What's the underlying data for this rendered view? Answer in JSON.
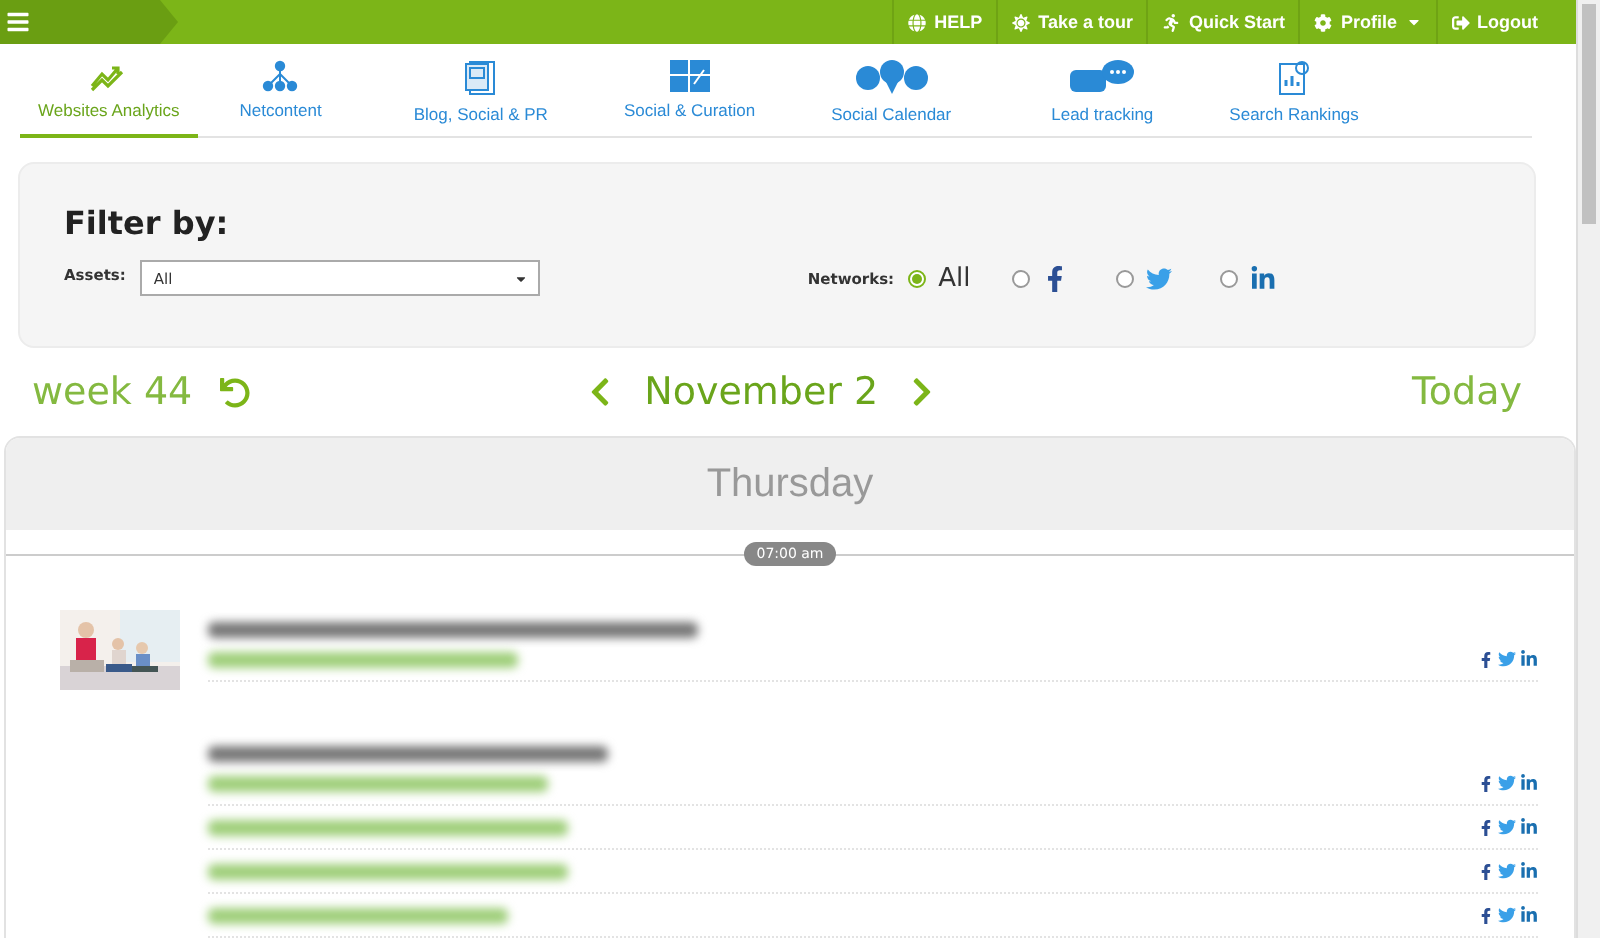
{
  "topbar": {
    "items": [
      {
        "label": "HELP",
        "kind": "link"
      },
      {
        "label": "Take a tour",
        "kind": "link"
      },
      {
        "label": "Quick Start",
        "kind": "link"
      },
      {
        "label": "Profile",
        "kind": "dropdown"
      },
      {
        "label": "Logout",
        "kind": "link"
      }
    ]
  },
  "tabs": [
    {
      "label": "Websites Analytics",
      "selected": true
    },
    {
      "label": "Netcontent",
      "selected": false
    },
    {
      "label": "Blog, Social & PR",
      "selected": false
    },
    {
      "label": "Social & Curation",
      "selected": false
    },
    {
      "label": "Social Calendar",
      "selected": false
    },
    {
      "label": "Lead tracking",
      "selected": false
    },
    {
      "label": "Search Rankings",
      "selected": false
    }
  ],
  "filter": {
    "title": "Filter by:",
    "assets": {
      "label": "Assets:",
      "value": "All"
    },
    "networks": {
      "label": "Networks:",
      "options": [
        {
          "kind": "text",
          "label": "All",
          "selected": true
        },
        {
          "kind": "facebook",
          "selected": false
        },
        {
          "kind": "twitter",
          "selected": false
        },
        {
          "kind": "linkedin",
          "selected": false
        }
      ]
    }
  },
  "date_nav": {
    "week": "week 44",
    "date": "November 2",
    "today": "Today"
  },
  "day": {
    "name": "Thursday",
    "time": "07:00 am"
  }
}
